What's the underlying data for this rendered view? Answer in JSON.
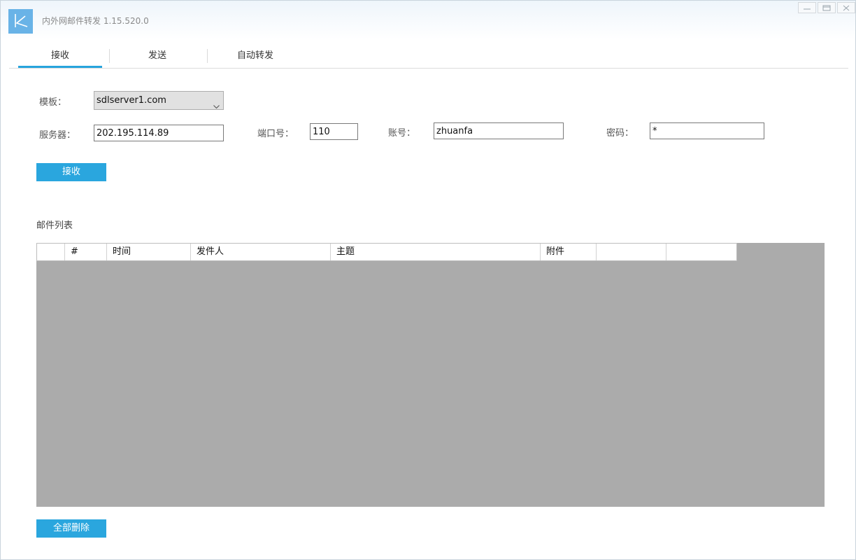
{
  "app": {
    "title": "内外网邮件转发 1.15.520.0"
  },
  "tabs": [
    {
      "label": "接收"
    },
    {
      "label": "发送"
    },
    {
      "label": "自动转发"
    }
  ],
  "form": {
    "template_label": "模板：",
    "template_value": "sdlserver1.com",
    "server_label": "服务器：",
    "server_value": "202.195.114.89",
    "port_label": "端口号：",
    "port_value": "110",
    "account_label": "账号：",
    "account_value": "zhuanfa",
    "password_label": "密码：",
    "password_value": "*"
  },
  "receive_button": "接收",
  "mail_list": {
    "title": "邮件列表",
    "columns": [
      "",
      "#",
      "时间",
      "发件人",
      "主题",
      "附件",
      "",
      ""
    ]
  },
  "delete_all_button": "全部删除",
  "colors": {
    "accent": "#27a4dd",
    "grid_background": "#ababab"
  }
}
